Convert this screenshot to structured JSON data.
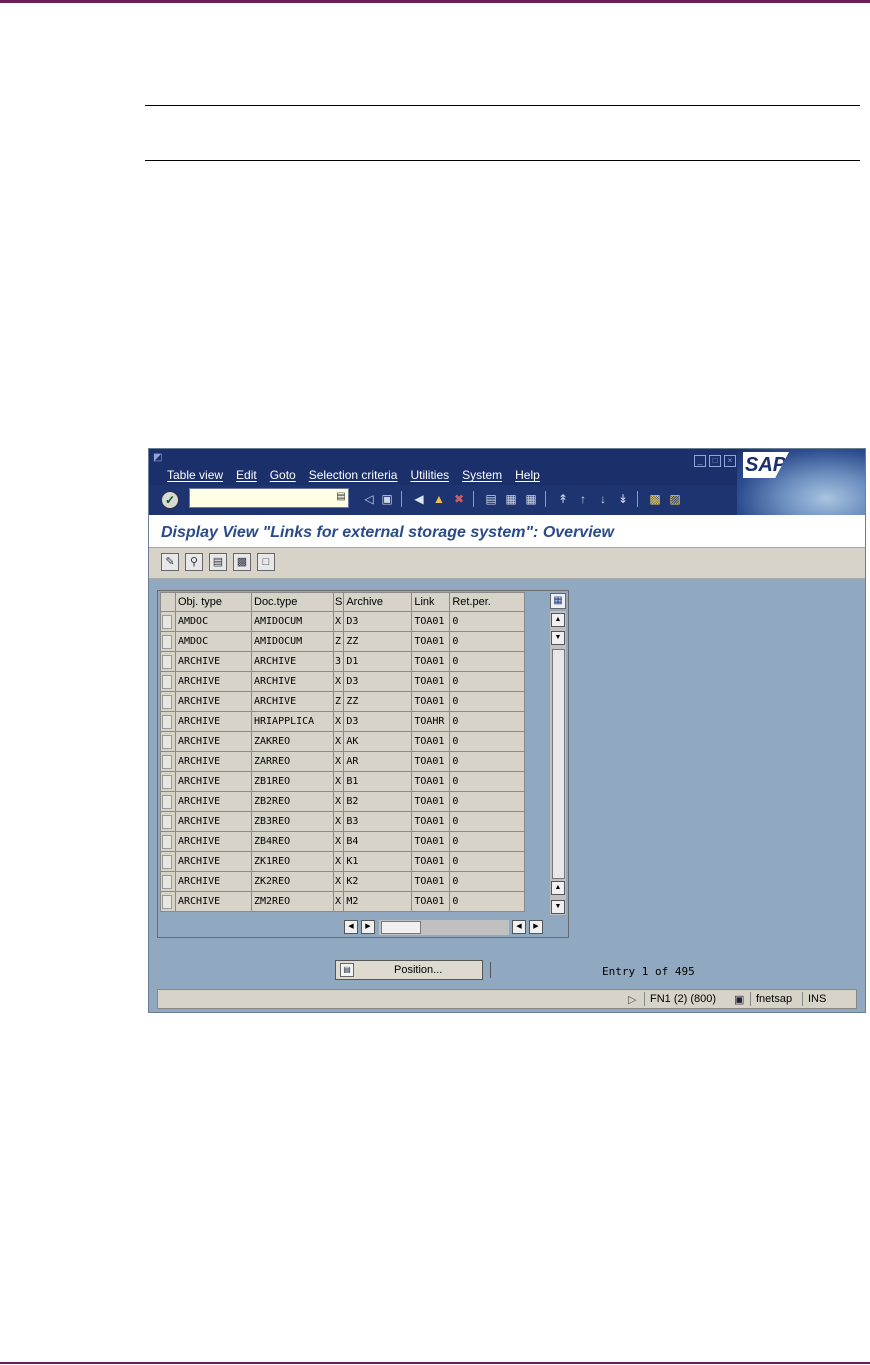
{
  "window": {
    "menu": [
      "Table view",
      "Edit",
      "Goto",
      "Selection criteria",
      "Utilities",
      "System",
      "Help"
    ],
    "logo": "SAP"
  },
  "title": "Display View \"Links for external storage system\": Overview",
  "table": {
    "headers": [
      "Obj. type",
      "Doc.type",
      "S",
      "Archive",
      "Link",
      "Ret.per."
    ],
    "rows": [
      [
        "AMDOC",
        "AMIDOCUM",
        "X",
        "D3",
        "TOA01",
        "0"
      ],
      [
        "AMDOC",
        "AMIDOCUM",
        "Z",
        "ZZ",
        "TOA01",
        "0"
      ],
      [
        "ARCHIVE",
        "ARCHIVE",
        "3",
        "D1",
        "TOA01",
        "0"
      ],
      [
        "ARCHIVE",
        "ARCHIVE",
        "X",
        "D3",
        "TOA01",
        "0"
      ],
      [
        "ARCHIVE",
        "ARCHIVE",
        "Z",
        "ZZ",
        "TOA01",
        "0"
      ],
      [
        "ARCHIVE",
        "HRIAPPLICA",
        "X",
        "D3",
        "TOAHR",
        "0"
      ],
      [
        "ARCHIVE",
        "ZAKREO",
        "X",
        "AK",
        "TOA01",
        "0"
      ],
      [
        "ARCHIVE",
        "ZARREO",
        "X",
        "AR",
        "TOA01",
        "0"
      ],
      [
        "ARCHIVE",
        "ZB1REO",
        "X",
        "B1",
        "TOA01",
        "0"
      ],
      [
        "ARCHIVE",
        "ZB2REO",
        "X",
        "B2",
        "TOA01",
        "0"
      ],
      [
        "ARCHIVE",
        "ZB3REO",
        "X",
        "B3",
        "TOA01",
        "0"
      ],
      [
        "ARCHIVE",
        "ZB4REO",
        "X",
        "B4",
        "TOA01",
        "0"
      ],
      [
        "ARCHIVE",
        "ZK1REO",
        "X",
        "K1",
        "TOA01",
        "0"
      ],
      [
        "ARCHIVE",
        "ZK2REO",
        "X",
        "K2",
        "TOA01",
        "0"
      ],
      [
        "ARCHIVE",
        "ZM2REO",
        "X",
        "M2",
        "TOA01",
        "0"
      ]
    ]
  },
  "position_button": "Position...",
  "entry_text": "Entry 1 of 495",
  "status": {
    "session": "FN1 (2) (800)",
    "server": "fnetsap",
    "mode": "INS"
  }
}
